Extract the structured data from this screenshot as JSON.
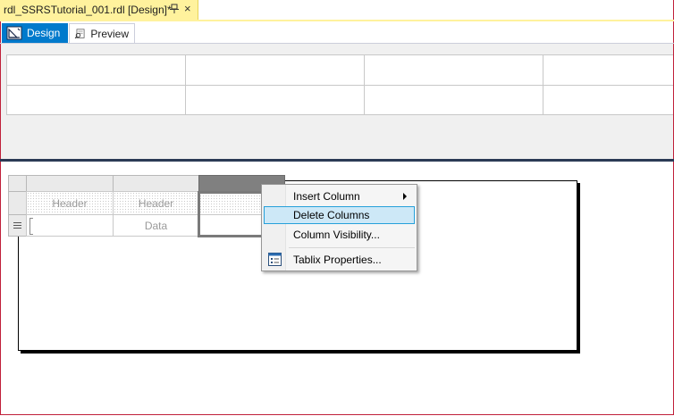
{
  "document_tab": {
    "title": "rdl_SSRSTutorial_001.rdl [Design]*",
    "pin_icon": "pin-icon",
    "close_glyph": "×"
  },
  "view_tabs": [
    {
      "label": "Design",
      "icon": "design-icon",
      "active": true
    },
    {
      "label": "Preview",
      "icon": "preview-icon",
      "active": false
    }
  ],
  "tablix": {
    "header_row": [
      "Header",
      "",
      ""
    ],
    "data_row": [
      "Data",
      "",
      ""
    ]
  },
  "context_menu": {
    "items": [
      {
        "label": "Insert Column",
        "has_submenu": true,
        "highlighted": false
      },
      {
        "label": "Delete Columns",
        "has_submenu": false,
        "highlighted": true
      },
      {
        "label": "Column Visibility...",
        "has_submenu": false,
        "highlighted": false
      },
      {
        "label": "Tablix Properties...",
        "has_submenu": false,
        "highlighted": false,
        "icon": "tablix-properties-icon"
      }
    ]
  },
  "colors": {
    "doc_tab_bg": "#fff29d",
    "design_tab_bg": "#007acc",
    "splitter": "#2b3a55",
    "menu_highlight": "#cde8f7",
    "menu_highlight_border": "#26a0da",
    "window_border": "#c0203a"
  }
}
